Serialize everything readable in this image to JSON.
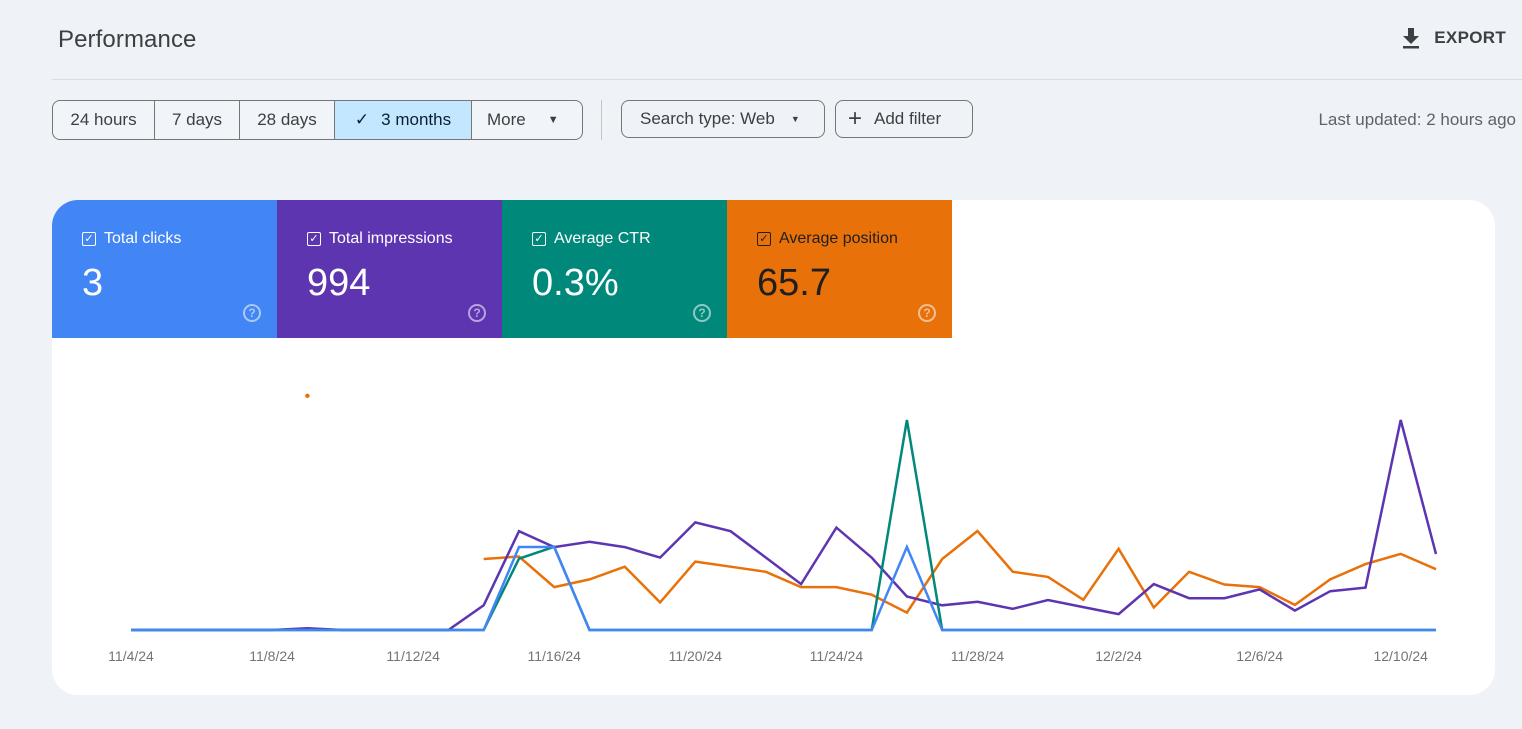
{
  "header": {
    "title": "Performance",
    "export_label": "EXPORT",
    "export_icon": "download-icon"
  },
  "filters": {
    "date_ranges": [
      {
        "label": "24 hours",
        "active": false
      },
      {
        "label": "7 days",
        "active": false
      },
      {
        "label": "28 days",
        "active": false
      },
      {
        "label": "3 months",
        "active": true
      },
      {
        "label": "More",
        "active": false
      }
    ],
    "search_type_label": "Search type: Web",
    "add_filter_label": "Add filter",
    "last_updated": "Last updated: 2 hours ago"
  },
  "metrics": [
    {
      "label": "Total clicks",
      "value": "3",
      "color": "#4285f4",
      "checked": true
    },
    {
      "label": "Total impressions",
      "value": "994",
      "color": "#5e35b1",
      "checked": true
    },
    {
      "label": "Average CTR",
      "value": "0.3%",
      "color": "#00897b",
      "checked": true
    },
    {
      "label": "Average position",
      "value": "65.7",
      "color": "#e8710a",
      "checked": true
    }
  ],
  "chart_data": {
    "type": "line",
    "title": "",
    "xlabel": "",
    "ylabel": "",
    "grid": false,
    "legend": "metric tiles (top)",
    "x": [
      "11/4/24",
      "11/5/24",
      "11/6/24",
      "11/7/24",
      "11/8/24",
      "11/9/24",
      "11/10/24",
      "11/11/24",
      "11/12/24",
      "11/13/24",
      "11/14/24",
      "11/15/24",
      "11/16/24",
      "11/17/24",
      "11/18/24",
      "11/19/24",
      "11/20/24",
      "11/21/24",
      "11/22/24",
      "11/23/24",
      "11/24/24",
      "11/25/24",
      "11/26/24",
      "11/27/24",
      "11/28/24",
      "11/29/24",
      "11/30/24",
      "12/1/24",
      "12/2/24",
      "12/3/24",
      "12/4/24",
      "12/5/24",
      "12/6/24",
      "12/7/24",
      "12/8/24",
      "12/9/24",
      "12/10/24",
      "12/11/24"
    ],
    "x_tick_labels": [
      "11/4/24",
      "11/8/24",
      "11/12/24",
      "11/16/24",
      "11/20/24",
      "11/24/24",
      "11/28/24",
      "12/2/24",
      "12/6/24",
      "12/10/24"
    ],
    "series": [
      {
        "name": "Total clicks",
        "color": "#4285f4",
        "ylim": [
          0,
          2.53
        ],
        "values": [
          0,
          0,
          0,
          0,
          0,
          0,
          0,
          0,
          0,
          0,
          0,
          1,
          1,
          0,
          0,
          0,
          0,
          0,
          0,
          0,
          0,
          0,
          1,
          0,
          0,
          0,
          0,
          0,
          0,
          0,
          0,
          0,
          0,
          0,
          0,
          0,
          0,
          0
        ]
      },
      {
        "name": "Total impressions",
        "color": "#5e35b1",
        "ylim": [
          0,
          119
        ],
        "values": [
          0,
          0,
          0,
          0,
          0,
          1,
          0,
          0,
          0,
          0,
          14,
          56,
          47,
          50,
          47,
          41,
          61,
          56,
          41,
          26,
          58,
          41,
          19,
          14,
          16,
          12,
          17,
          13,
          9,
          26,
          18,
          18,
          23,
          11,
          22,
          24,
          119,
          43
        ]
      },
      {
        "name": "Average CTR",
        "color": "#00897b",
        "unit": "%",
        "ylim": [
          0,
          5.3
        ],
        "values": [
          0,
          0,
          0,
          0,
          0,
          0,
          0,
          0,
          0,
          0,
          0,
          1.8,
          2.1,
          0,
          0,
          0,
          0,
          0,
          0,
          0,
          0,
          0,
          5.3,
          0,
          0,
          0,
          0,
          0,
          0,
          0,
          0,
          0,
          0,
          0,
          0,
          0,
          0,
          0
        ]
      },
      {
        "name": "Average position",
        "color": "#e8710a",
        "inverted": true,
        "ylim": [
          0,
          98
        ],
        "values": [
          null,
          null,
          null,
          null,
          null,
          5,
          null,
          null,
          null,
          null,
          69,
          68,
          80,
          77,
          72,
          86,
          70,
          72,
          74,
          80,
          80,
          83,
          90,
          69,
          58,
          74,
          76,
          85,
          65,
          88,
          74,
          79,
          80,
          87,
          77,
          71,
          67,
          73
        ]
      }
    ]
  }
}
